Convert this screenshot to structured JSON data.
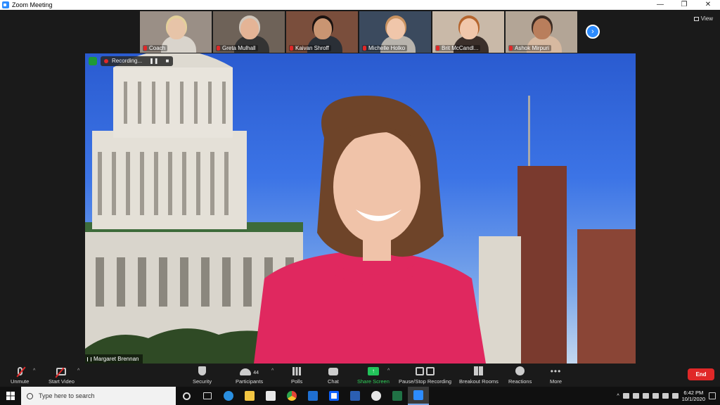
{
  "window": {
    "title": "Zoom Meeting",
    "minimize": "—",
    "restore": "❐",
    "close": "✕"
  },
  "view": {
    "label": "View"
  },
  "participants": [
    {
      "name": "Coach",
      "bg": "#9a8f86",
      "skin": "#e7c4a8",
      "hair": "#e3d09a",
      "shirt": "#d9d4cc"
    },
    {
      "name": "Greta Mulhall",
      "bg": "#6e6258",
      "skin": "#e4b496",
      "hair": "#cfc6bb",
      "shirt": "#333333"
    },
    {
      "name": "Kaivan Shroff",
      "bg": "#7a4e3c",
      "skin": "#c99572",
      "hair": "#1a1210",
      "shirt": "#2a2f36"
    },
    {
      "name": "Michelle Holko",
      "bg": "#3b4a5e",
      "skin": "#f0c6aa",
      "hair": "#c89260",
      "shirt": "#b8b4ad"
    },
    {
      "name": "Brit McCandl...",
      "bg": "#c9b9a8",
      "skin": "#f1c7ab",
      "hair": "#b5652e",
      "shirt": "#3b2f2a"
    },
    {
      "name": "Ashok Mirpuri",
      "bg": "#b3a596",
      "skin": "#b97e5c",
      "hair": "#3a2a22",
      "shirt": "#d7b9a0"
    }
  ],
  "main": {
    "speaker": "Margaret Brennan",
    "recording_label": "Recording...",
    "pause_glyph": "❚❚",
    "stop_glyph": "■"
  },
  "toolbar": {
    "unmute": "Unmute",
    "start_video": "Start Video",
    "security": "Security",
    "participants": "Participants",
    "participant_count": "44",
    "polls": "Polls",
    "chat": "Chat",
    "share_screen": "Share Screen",
    "pause_stop_recording": "Pause/Stop Recording",
    "breakout_rooms": "Breakout Rooms",
    "reactions": "Reactions",
    "more": "More",
    "end": "End",
    "caret": "^",
    "share_arrow": "↑",
    "dots": "•••"
  },
  "taskbar": {
    "search_placeholder": "Type here to search",
    "time": "6:42 PM",
    "date": "10/1/2020",
    "tray_caret": "^"
  },
  "colors": {
    "accent": "#2d8cff",
    "end_red": "#e02828",
    "share_green": "#22c35a"
  }
}
